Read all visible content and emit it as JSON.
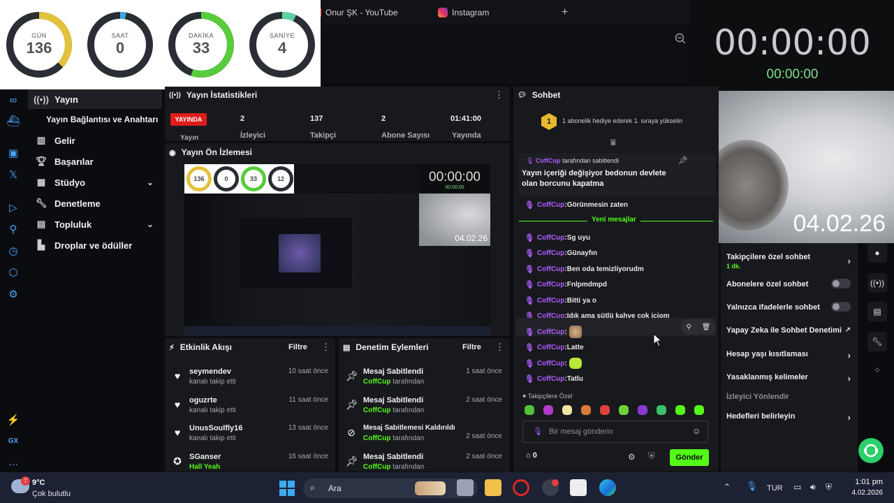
{
  "browser": {
    "tabs": [
      {
        "label": "Onur ŞK - YouTube",
        "icon": "youtube-icon"
      },
      {
        "label": "Instagram",
        "icon": "instagram-icon"
      }
    ],
    "new_tab": "+"
  },
  "countdown": {
    "rings": [
      {
        "label": "GÜN",
        "value": "136",
        "fraction": 0.37,
        "color": "#e2c23a"
      },
      {
        "label": "SAAT",
        "value": "0",
        "fraction": 0.03,
        "color": "#3aa9e2"
      },
      {
        "label": "DAKİKA",
        "value": "33",
        "fraction": 0.55,
        "color": "#58cc3c"
      },
      {
        "label": "SANİYE",
        "value": "4",
        "fraction": 0.07,
        "color": "#5fd1a4"
      }
    ]
  },
  "clock": {
    "big": "00:00:00",
    "small": "00:00:00"
  },
  "webcam": {
    "date": "04.02.26"
  },
  "nav": {
    "items": [
      {
        "label": "Yayın",
        "icon": "broadcast-icon"
      },
      {
        "label": "Yayın Bağlantısı ve Anahtarı",
        "icon": ""
      },
      {
        "label": "Gelir",
        "icon": "chart-icon"
      },
      {
        "label": "Başarılar",
        "icon": "trophy-icon"
      },
      {
        "label": "Stüdyo",
        "icon": "studio-icon"
      },
      {
        "label": "Denetleme",
        "icon": "wrench-icon"
      },
      {
        "label": "Topluluk",
        "icon": "community-icon"
      },
      {
        "label": "Droplar ve ödüller",
        "icon": "drops-icon"
      }
    ]
  },
  "rail": {
    "bottom_labels": [
      "GX"
    ]
  },
  "stats": {
    "title": "Yayın İstatistikleri",
    "badge": "YAYINDA",
    "items": [
      {
        "value": "2",
        "label": "İzleyici"
      },
      {
        "value": "137",
        "label": "Takipçi"
      },
      {
        "value": "2",
        "label": "Abone Sayısı"
      },
      {
        "value": "01:41:00",
        "label": "Yayında"
      }
    ],
    "cut_label": "Yayın"
  },
  "preview": {
    "title": "Yayın Ön İzlemesi",
    "mini_rings": [
      "136",
      "0",
      "33",
      "12"
    ],
    "mini_clock": "00:00:00",
    "mini_clock_small": "00:00:00",
    "mini_date": "04.02.26"
  },
  "activity": {
    "title": "Etkinlik Akışı",
    "filter": "Filtre",
    "items": [
      {
        "name": "seymendev",
        "sub": "kanalı takip etti",
        "time": "10 saat önce",
        "icon": "heart-icon"
      },
      {
        "name": "oguzrte",
        "sub": "kanalı takip etti",
        "time": "11 saat önce",
        "icon": "heart-icon"
      },
      {
        "name": "UnusSoulfly16",
        "sub": "kanalı takip etti",
        "time": "13 saat önce",
        "icon": "heart-icon"
      },
      {
        "name": "SGanser",
        "sub": "Hall Yeah",
        "time": "16 saat önce",
        "icon": "kick-icon"
      }
    ]
  },
  "modactions": {
    "title": "Denetim Eylemleri",
    "filter": "Filtre",
    "items": [
      {
        "name": "Mesaj Sabitlendi",
        "by": "CoffCup",
        "suffix": "tarafından",
        "time": "1 saat önce",
        "icon": "pin-icon"
      },
      {
        "name": "Mesaj Sabitlendi",
        "by": "CoffCup",
        "suffix": "tarafından",
        "time": "2 saat önce",
        "icon": "pin-icon"
      },
      {
        "name": "Mesaj Sabitlemesi Kaldırıldı",
        "by": "CoffCup",
        "suffix": "tarafından",
        "time": "2 saat önce",
        "icon": "unpin-icon"
      },
      {
        "name": "Mesaj Sabitlendi",
        "by": "CoffCup",
        "suffix": "tarafından",
        "time": "2 saat önce",
        "icon": "pin-icon"
      }
    ]
  },
  "chat": {
    "title": "Sohbet",
    "gift_text": "1 abonelik hediye ederek 1. sıraya yükselin",
    "gift_badge": "1",
    "pinned": {
      "by": "CoffCup",
      "suffix": "tarafından sabitlendi",
      "text": "Yayın içeriği değişiyor bedonun devlete olan borcunu kapatma"
    },
    "before_messages": [
      {
        "user": "CoffCup",
        "text": "Görünmesin zaten"
      }
    ],
    "new_messages_label": "Yeni mesajlar",
    "messages": [
      {
        "user": "CoffCup",
        "text": "Sg uyu"
      },
      {
        "user": "CoffCup",
        "text": "Günayfın"
      },
      {
        "user": "CoffCup",
        "text": "Ben oda temizliyorudm"
      },
      {
        "user": "CoffCup",
        "text": "Fnlpmdmpd"
      },
      {
        "user": "CoffCup",
        "text": "Bitti ya o"
      },
      {
        "user": "CoffCup",
        "text": "Idık ama sütlü kahve çok içiom"
      },
      {
        "user": "CoffCup",
        "text": ""
      },
      {
        "user": "CoffCup",
        "text": "Latte"
      },
      {
        "user": "CoffCup",
        "text": ""
      },
      {
        "user": "CoffCup",
        "text": "Tatlu"
      }
    ],
    "emote_section": "Takipçilere Özel",
    "input_placeholder": "Bir mesaj gönderin",
    "points": "0",
    "send": "Gönder"
  },
  "settings": {
    "rows": [
      {
        "label": "Takipçilere özel sohbet",
        "sub": "1 dk.",
        "control": "chevron"
      },
      {
        "label": "Abonelere özel sohbet",
        "control": "toggle"
      },
      {
        "label": "Yalnızca ifadelerle sohbet",
        "control": "toggle"
      },
      {
        "label": "Yapay Zeka ile Sohbet Denetimi",
        "control": "external"
      },
      {
        "label": "Hesap yaşı kısıtlaması",
        "control": "chevron"
      },
      {
        "label": "Yasaklanmış kelimeler",
        "control": "chevron"
      },
      {
        "label": "İzleyici Yönlendir",
        "control": "none"
      },
      {
        "label": "Hedefleri belirleyin",
        "control": "chevron"
      }
    ]
  },
  "taskbar": {
    "weather_temp": "9°C",
    "weather_desc": "Çok bulutlu",
    "weather_badge": "7",
    "search": "Ara",
    "lang": "TUR",
    "time": "1:01 pm",
    "date": "4.02.2026"
  }
}
